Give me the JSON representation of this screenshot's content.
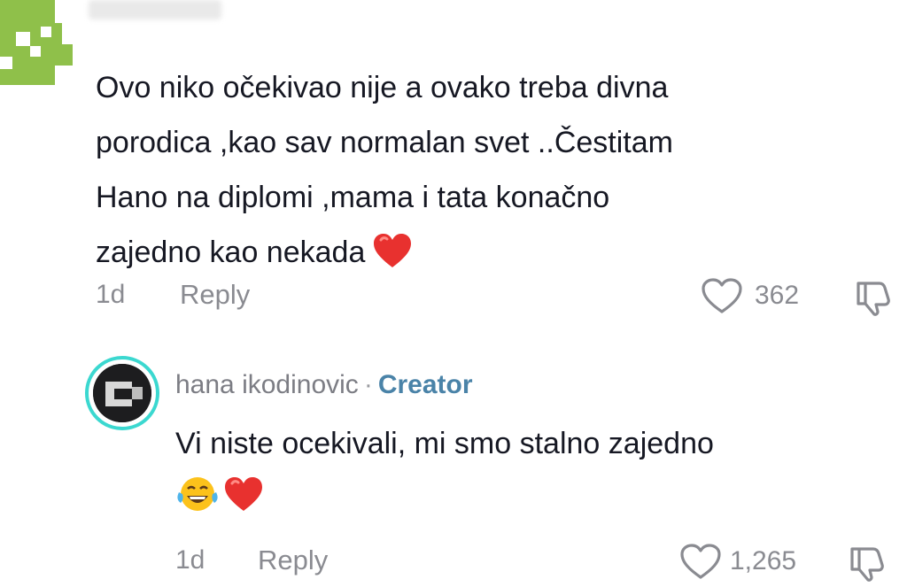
{
  "top_comment": {
    "username": "",
    "text_lines": [
      "Ovo niko očekivao nije a ovako treba divna",
      "porodica ,kao sav normalan svet ..Čestitam",
      "Hano na diplomi ,mama i tata konačno",
      "zajedno kao nekada"
    ],
    "emoji": "red-heart",
    "age": "1d",
    "reply_label": "Reply",
    "like_count": "362"
  },
  "reply_comment": {
    "username": "hana ikodinovic",
    "separator": "·",
    "badge": "Creator",
    "text": "Vi niste ocekivali, mi smo stalno zajedno",
    "emojis": [
      "face-with-tears-of-joy",
      "red-heart"
    ],
    "age": "1d",
    "reply_label": "Reply",
    "like_count": "1,265"
  },
  "colors": {
    "text_primary": "#161823",
    "text_secondary": "#8a8b91",
    "creator_badge": "#4a83a8",
    "avatar_ring": "#3bd8d0",
    "heart": "#e8312f",
    "pixel_avatar": "#8fc04a"
  }
}
